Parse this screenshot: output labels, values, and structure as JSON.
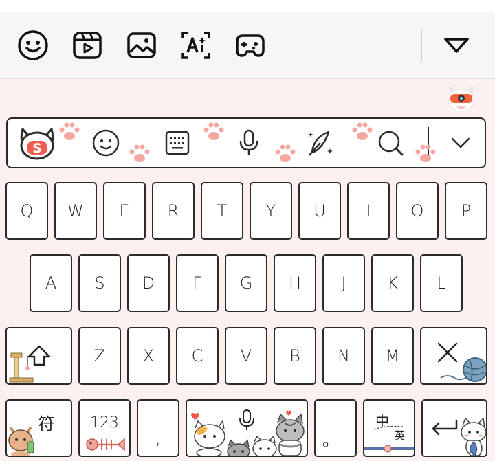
{
  "toolbar": {
    "items": [
      {
        "icon": "emoji-icon"
      },
      {
        "icon": "clip-video-icon"
      },
      {
        "icon": "image-icon"
      },
      {
        "icon": "ai-text-icon"
      },
      {
        "icon": "gamepad-icon"
      }
    ],
    "collapse_icon": "triangle-down-icon"
  },
  "candidate_bar": {
    "items": [
      {
        "icon": "sogou-cat-logo-icon"
      },
      {
        "icon": "smiley-icon"
      },
      {
        "icon": "keyboard-icon"
      },
      {
        "icon": "microphone-icon"
      },
      {
        "icon": "quill-pen-icon"
      },
      {
        "icon": "search-icon"
      },
      {
        "icon": "chevron-down-icon"
      }
    ],
    "logo_text": "S"
  },
  "keyboard": {
    "row1": [
      "Q",
      "W",
      "E",
      "R",
      "T",
      "Y",
      "U",
      "I",
      "O",
      "P"
    ],
    "row2": [
      "A",
      "S",
      "D",
      "F",
      "G",
      "H",
      "J",
      "K",
      "L"
    ],
    "row3": [
      "Z",
      "X",
      "C",
      "V",
      "B",
      "N",
      "M"
    ],
    "symbols_label": "符",
    "numbers_label": "123",
    "comma_label": ",",
    "period_label": "。",
    "lang_label_main": "中",
    "lang_label_sub": "英"
  },
  "colors": {
    "background": "#fdf1ef",
    "key_border": "#2b2b2b",
    "paw_pink": "#f6a7a2",
    "logo_red": "#f25b4f"
  }
}
